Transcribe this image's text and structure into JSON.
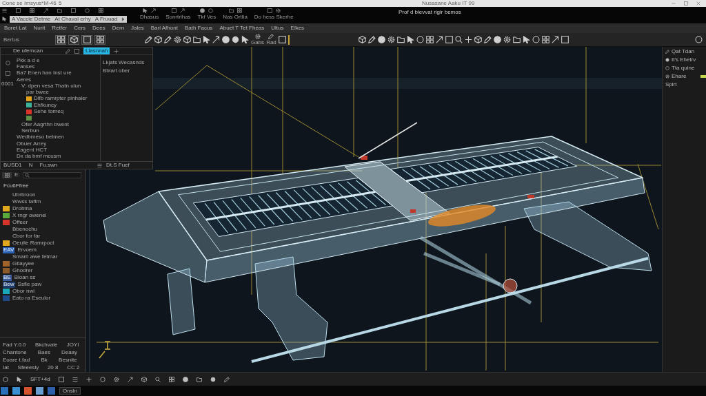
{
  "window": {
    "title": "Cone se Imsyus*M-46",
    "badge": "5",
    "document": "Nusasane Aaku IT 99"
  },
  "header": {
    "caption": "Prof d blevvat rigir bemos",
    "quick_access": [
      "A Vaccie Detme",
      "At Chaval erhy",
      "A Fruuad"
    ],
    "tools": [
      "Dhasus",
      "Sonrtrihas",
      "Tkf Ves",
      "Nas Ortlia",
      "Do hess Skerhe"
    ]
  },
  "menu": [
    "Boret Lat",
    "Nurit",
    "Retfer",
    "Cers",
    "Dees",
    "Dern",
    "Jales",
    "Bari Afhont",
    "Bath Facus",
    "Abuet T Tet Fheas",
    "Ultus",
    "Elkes"
  ],
  "toolbar": {
    "label": "Bertus",
    "tool_labels": [
      "Gabs",
      "Rad"
    ]
  },
  "palette": {
    "title": "De ufemcan",
    "tabs": [
      {
        "label": "Llasnnah",
        "selected": true
      }
    ],
    "gutter_label": "0001",
    "tree": [
      {
        "label": "Pkk a d e"
      },
      {
        "label": "Fanses"
      },
      {
        "label": "Ba7 Enen han Inst ure"
      },
      {
        "label": "Aeres",
        "children": [
          {
            "label": "V: dpen vesa Thatn ulun",
            "children": [
              {
                "label": "par bwee"
              },
              {
                "label": "Dlfb ramrpter pinhaler",
                "color": "#e2a21c"
              },
              {
                "label": "Ehfkuncy",
                "color": "#3bb39a"
              },
              {
                "label": "Sehe tomeq",
                "color": "#d9352a"
              },
              {
                "color": "#5e8f45"
              }
            ]
          },
          {
            "label": "Ofer Aagrthn bwent"
          },
          {
            "label": "Serbun"
          }
        ]
      },
      {
        "label": "Wedbmeso belmen"
      },
      {
        "label": "Obuer Arrey"
      },
      {
        "label": "Eagent HCT"
      },
      {
        "label": "Dx da bmf mcusm"
      }
    ],
    "notes": [
      "Lkjats Wecasnds",
      "Bblart ober"
    ],
    "footer": {
      "left": [
        "BUSD1",
        "N",
        "Fu.swn"
      ],
      "right": "Dt.S Fuef"
    }
  },
  "layers": {
    "filter_label": "E:",
    "title": "Fcu6Ffree",
    "items": [
      {
        "label": "Ubrbroon"
      },
      {
        "label": "Wwss taftm"
      },
      {
        "label": "Drobma",
        "color": "#e0a81e"
      },
      {
        "label": "X rngr owenel",
        "color": "#5aa83c"
      },
      {
        "label": "Offeer",
        "color": "#d9342b"
      },
      {
        "label": "Bbenochu"
      },
      {
        "label": "Cbor for far"
      },
      {
        "label": "Oeulte Ramrpoct",
        "color": "#e0a81e"
      },
      {
        "label": "Ervoem",
        "color": "#2a62b8",
        "tag": "EAV"
      },
      {
        "label": "Smarrl awe fetmar"
      },
      {
        "label": "Gtlayyee",
        "color": "#a0642a"
      },
      {
        "label": "Ghodrer",
        "color": "#8a5a2a"
      },
      {
        "label": "Bloan ss",
        "color": "#3a5a9a",
        "tag": "BE"
      },
      {
        "label": "Ssfie paw",
        "color": "#1e3a6a",
        "tag": "Bew"
      },
      {
        "label": "Obor nwi",
        "color": "#1aa8b8"
      },
      {
        "label": "Eato ra Eseulor",
        "color": "#1e4a8a"
      }
    ]
  },
  "properties": {
    "rows": [
      [
        "Fad Y.0.0",
        "Bkchvale",
        "JOYI"
      ],
      [
        "Chantone",
        "Baes",
        "Deaay"
      ],
      [
        "Eoare t.fad",
        "Bk",
        "Besnite"
      ],
      [
        "Iat",
        "Sfeeesiy",
        "20 8",
        "CC 2"
      ]
    ]
  },
  "right_panel": {
    "items": [
      {
        "label": "Qat Tdan"
      },
      {
        "label": "It's Ehetrv"
      },
      {
        "label": "Tta quine"
      },
      {
        "label": "Ehare",
        "color": "#c6d84e"
      }
    ],
    "section": "Spirt"
  },
  "status_bar": {
    "readout": "SFT+4d"
  },
  "taskbar": {
    "search": "Onsln"
  }
}
